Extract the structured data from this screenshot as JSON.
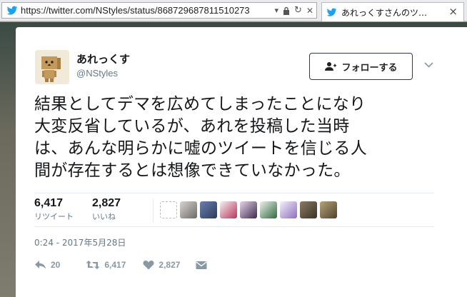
{
  "browser": {
    "url_main": "https://twitter.com",
    "url_path": "/NStyles/status/868729687811510273",
    "tab_title": "あれっくすさんのツ…"
  },
  "tweet": {
    "user": {
      "display_name": "あれっくす",
      "handle": "@NStyles"
    },
    "follow_label": "フォローする",
    "lines": [
      "結果としてデマを広めてしまったことになり",
      "大変反省しているが、あれを投稿した当時",
      "は、あんな明らかに嘘のツイートを信じる人",
      "間が存在するとは想像できていなかった。"
    ],
    "retweets": {
      "count": "6,417",
      "label": "リツイート"
    },
    "likes": {
      "count": "2,827",
      "label": "いいね"
    },
    "timestamp": "0:24 - 2017年5月28日",
    "actions": {
      "reply_count": "20",
      "retweet_count": "6,417",
      "like_count": "2,827"
    }
  },
  "colors": {
    "twitter_blue": "#1da1f2",
    "text": "#14171a",
    "muted": "#657786",
    "action_gray": "#8899a6"
  },
  "icons": [
    "twitter-bird-icon",
    "dropdown-icon",
    "lock-icon",
    "reload-icon",
    "close-icon",
    "person-add-icon",
    "chevron-down-icon",
    "reply-icon",
    "retweet-icon",
    "heart-icon",
    "envelope-icon"
  ]
}
